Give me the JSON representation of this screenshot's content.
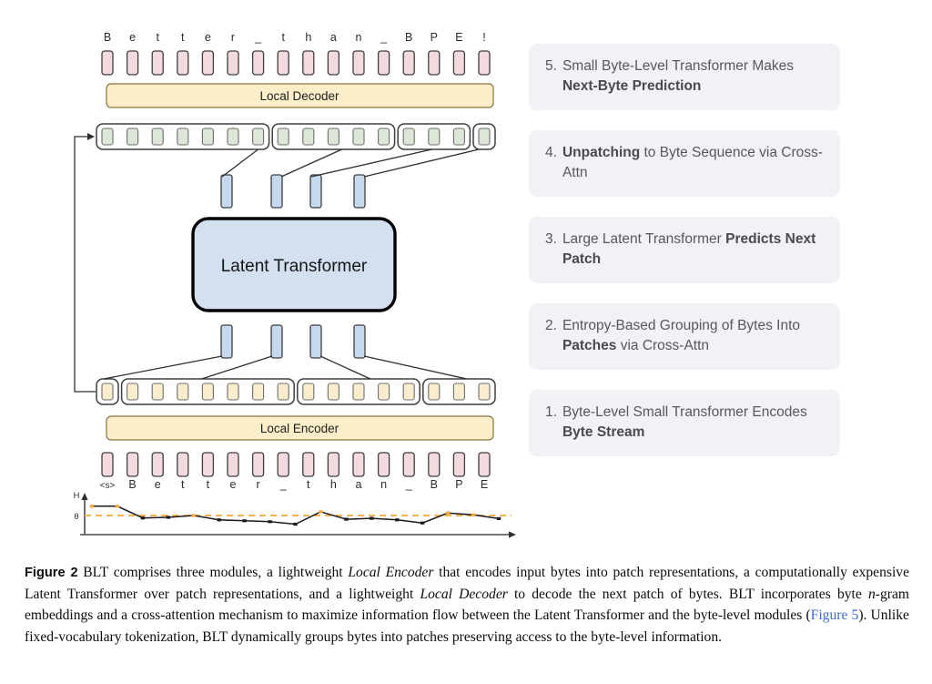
{
  "figure": {
    "top_sequence": [
      "B",
      "e",
      "t",
      "t",
      "e",
      "r",
      "_",
      "t",
      "h",
      "a",
      "n",
      "_",
      "B",
      "P",
      "E",
      "!"
    ],
    "bottom_sequence": [
      "<s>",
      "B",
      "e",
      "t",
      "t",
      "e",
      "r",
      "_",
      "t",
      "h",
      "a",
      "n",
      "_",
      "B",
      "P",
      "E"
    ],
    "local_decoder_label": "Local Decoder",
    "local_encoder_label": "Local Encoder",
    "latent_transformer_label": "Latent Transformer",
    "decoder_patch_groups": [
      7,
      5,
      3,
      1
    ],
    "encoder_patch_groups": [
      1,
      7,
      5,
      3
    ],
    "patch_vector_count": 4,
    "entropy_axis_top_label": "H",
    "entropy_threshold_label": "θ",
    "colors": {
      "byte_pink": "#f2dade",
      "byte_green": "#dde7d7",
      "byte_yellow": "#faedcd",
      "patch_blue": "#c6d9ef",
      "module_yellow": "#fbeec9",
      "latent_blue": "#d2e0f0",
      "card_gray": "#f2f2f6",
      "threshold_orange": "#f5a63b",
      "stroke_dark": "#3f3f3f",
      "xref_blue": "#4169d6"
    },
    "entropy_plot": {
      "type": "line",
      "title": "",
      "xlabel": "",
      "ylabel": "H",
      "threshold": 0.5,
      "x": [
        1,
        2,
        3,
        4,
        5,
        6,
        7,
        8,
        9,
        10,
        11,
        12,
        13,
        14,
        15,
        16
      ],
      "y": [
        0.8,
        0.8,
        0.42,
        0.44,
        0.5,
        0.36,
        0.33,
        0.3,
        0.22,
        0.62,
        0.38,
        0.41,
        0.36,
        0.26,
        0.58,
        0.52,
        0.4
      ],
      "above_threshold_points": [
        1,
        2,
        5,
        10,
        15
      ]
    }
  },
  "steps": [
    {
      "num": "5.",
      "pre": "Small Byte-Level Transformer Makes ",
      "bold": "Next-Byte Prediction",
      "post": ""
    },
    {
      "num": "4.",
      "pre": "",
      "bold": "Unpatching",
      "post": " to Byte Sequence via Cross-Attn"
    },
    {
      "num": "3.",
      "pre": "Large Latent Transformer ",
      "bold": "Predicts Next Patch",
      "post": ""
    },
    {
      "num": "2.",
      "pre": "Entropy-Based Grouping of Bytes Into ",
      "bold": "Patches",
      "post": " via Cross-Attn"
    },
    {
      "num": "1.",
      "pre": "Byte-Level Small Transformer Encodes ",
      "bold": "Byte Stream",
      "post": ""
    }
  ],
  "caption": {
    "label": "Figure 2",
    "segments": [
      {
        "t": "  BLT comprises three modules, a lightweight "
      },
      {
        "t": "Local Encoder",
        "style": "italic"
      },
      {
        "t": " that encodes input bytes into patch representations, a computationally expensive Latent Transformer over patch representations, and a lightweight "
      },
      {
        "t": "Local Decoder",
        "style": "italic"
      },
      {
        "t": " to decode the next patch of bytes. BLT incorporates byte "
      },
      {
        "t": "n",
        "style": "mathit"
      },
      {
        "t": "-gram embeddings and a cross-attention mechanism to maximize information flow between the Latent Transformer and the byte-level modules ("
      },
      {
        "t": "Figure 5",
        "style": "xref"
      },
      {
        "t": ").  Unlike fixed-vocabulary tokenization, BLT dynamically groups bytes into patches preserving access to the byte-level information."
      }
    ]
  }
}
